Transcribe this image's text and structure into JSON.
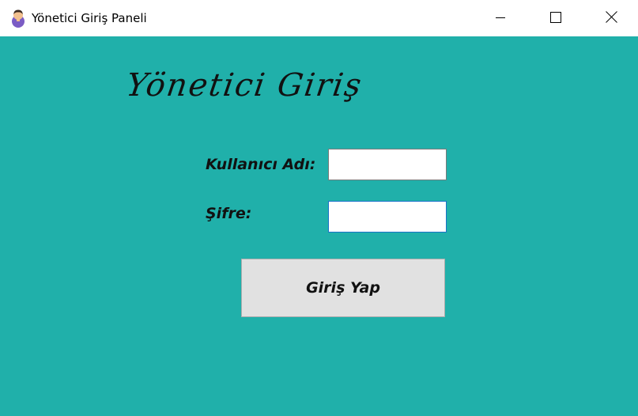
{
  "window": {
    "title": "Yönetici Giriş Paneli",
    "app_icon": "user-avatar-icon",
    "controls": [
      "minimize-icon",
      "maximize-icon",
      "close-icon"
    ]
  },
  "form": {
    "heading": "Yönetici Giriş",
    "username_label": "Kullanıcı Adı:",
    "username_value": "",
    "password_label": "Şifre:",
    "password_value": "",
    "submit_label": "Giriş Yap"
  },
  "colors": {
    "background": "#20b0aa",
    "button": "#e1e1e1",
    "focus_border": "#1a73c8"
  }
}
